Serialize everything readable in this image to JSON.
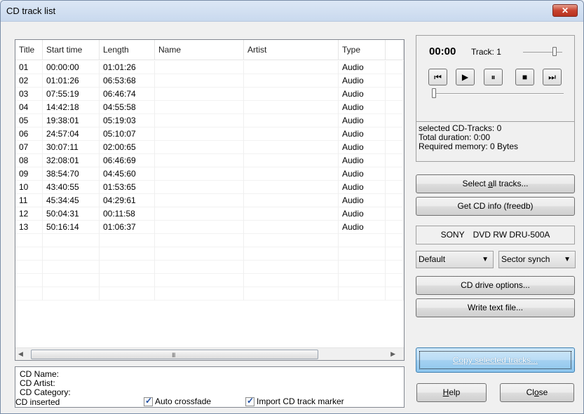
{
  "window": {
    "title": "CD track list",
    "close_label": "✕"
  },
  "table": {
    "headers": [
      "Title",
      "Start time",
      "Length",
      "Name",
      "Artist",
      "Type"
    ],
    "rows": [
      [
        "01",
        "00:00:00",
        "01:01:26",
        "",
        "",
        "Audio"
      ],
      [
        "02",
        "01:01:26",
        "06:53:68",
        "",
        "",
        "Audio"
      ],
      [
        "03",
        "07:55:19",
        "06:46:74",
        "",
        "",
        "Audio"
      ],
      [
        "04",
        "14:42:18",
        "04:55:58",
        "",
        "",
        "Audio"
      ],
      [
        "05",
        "19:38:01",
        "05:19:03",
        "",
        "",
        "Audio"
      ],
      [
        "06",
        "24:57:04",
        "05:10:07",
        "",
        "",
        "Audio"
      ],
      [
        "07",
        "30:07:11",
        "02:00:65",
        "",
        "",
        "Audio"
      ],
      [
        "08",
        "32:08:01",
        "06:46:69",
        "",
        "",
        "Audio"
      ],
      [
        "09",
        "38:54:70",
        "04:45:60",
        "",
        "",
        "Audio"
      ],
      [
        "10",
        "43:40:55",
        "01:53:65",
        "",
        "",
        "Audio"
      ],
      [
        "11",
        "45:34:45",
        "04:29:61",
        "",
        "",
        "Audio"
      ],
      [
        "12",
        "50:04:31",
        "00:11:58",
        "",
        "",
        "Audio"
      ],
      [
        "13",
        "50:16:14",
        "01:06:37",
        "",
        "",
        "Audio"
      ]
    ],
    "empty_rows": 5
  },
  "cd_info": {
    "name_label": "CD Name:",
    "artist_label": "CD Artist:",
    "category_label": "CD Category:"
  },
  "status": {
    "cd_inserted": "CD inserted",
    "auto_crossfade": "Auto crossfade",
    "import_marker": "Import CD track marker"
  },
  "player": {
    "time": "00:00",
    "track": "Track: 1"
  },
  "stats": {
    "selected": "selected CD-Tracks: 0",
    "duration": "Total duration:  0:00",
    "memory": "Required memory: 0 Bytes"
  },
  "buttons": {
    "select_all_pre": "Select ",
    "select_all_u": "a",
    "select_all_post": "ll tracks...",
    "get_cd_info": "Get CD info (freedb)",
    "drive_options": "CD drive options...",
    "write_text": "Write text file...",
    "copy_u": "C",
    "copy_post": "opy selected tracks...",
    "help_u": "H",
    "help_post": "elp",
    "close_pre": "Cl",
    "close_u": "o",
    "close_post": "se"
  },
  "drive": {
    "vendor": "SONY",
    "model": "DVD RW DRU-500A"
  },
  "selects": {
    "profile": "Default",
    "mode": "Sector synch"
  },
  "icons": [
    "prev-track-icon",
    "play-icon",
    "pause-icon",
    "stop-icon",
    "next-track-icon"
  ]
}
